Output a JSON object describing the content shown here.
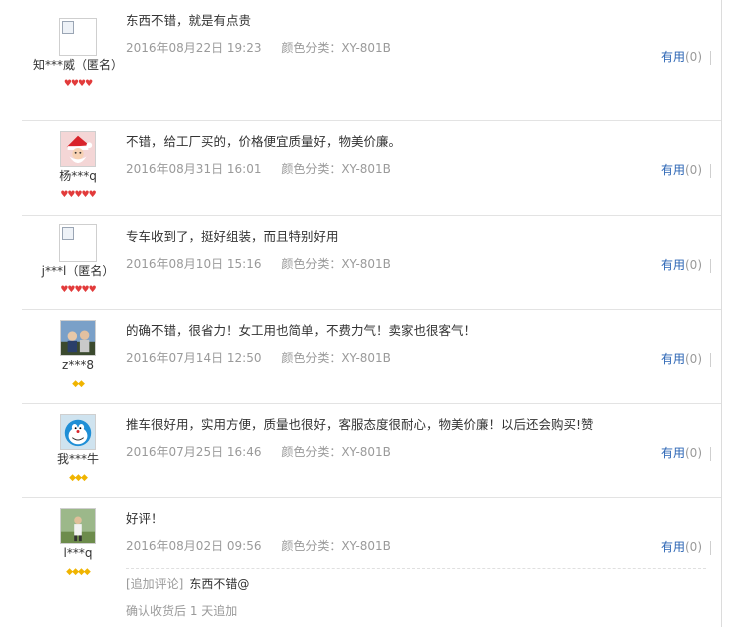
{
  "reviews": [
    {
      "user": "知***威（匿名）",
      "avatar": "broken-image-icon",
      "rank": "♥♥♥♥",
      "rank_type": "heart",
      "text": "东西不错，就是有点贵",
      "date": "2016年08月22日 19:23",
      "color": "颜色分类：XY-801B",
      "useful_label": "有用",
      "useful_count": "(0)"
    },
    {
      "user": "杨***q",
      "avatar": "santa-avatar",
      "rank": "♥♥♥♥♥",
      "rank_type": "heart",
      "text": "不错，给工厂买的，价格便宜质量好，物美价廉。",
      "date": "2016年08月31日 16:01",
      "color": "颜色分类：XY-801B",
      "useful_label": "有用",
      "useful_count": "(0)"
    },
    {
      "user": "j***l（匿名）",
      "avatar": "broken-image-icon",
      "rank": "♥♥♥♥♥",
      "rank_type": "heart",
      "text": "专车收到了，挺好组装，而且特别好用",
      "date": "2016年08月10日 15:16",
      "color": "颜色分类：XY-801B",
      "useful_label": "有用",
      "useful_count": "(0)"
    },
    {
      "user": "z***8",
      "avatar": "photo-avatar",
      "rank": "◆◆",
      "rank_type": "diamond",
      "text": "的确不错，很省力！女工用也简单，不费力气！卖家也很客气！",
      "date": "2016年07月14日 12:50",
      "color": "颜色分类：XY-801B",
      "useful_label": "有用",
      "useful_count": "(0)"
    },
    {
      "user": "我***牛",
      "avatar": "doraemon-avatar",
      "rank": "◆◆◆",
      "rank_type": "diamond",
      "text": "推车很好用，实用方便，质量也很好，客服态度很耐心，物美价廉！以后还会购买!赞",
      "date": "2016年07月25日 16:46",
      "color": "颜色分类：XY-801B",
      "useful_label": "有用",
      "useful_count": "(0)"
    },
    {
      "user": "l***q",
      "avatar": "outdoor-photo-avatar",
      "rank": "◆◆◆◆",
      "rank_type": "diamond",
      "text": "好评！",
      "date": "2016年08月02日 09:56",
      "color": "颜色分类：XY-801B",
      "useful_label": "有用",
      "useful_count": "(0)",
      "append_tag": "[追加评论]",
      "append_text": "东西不错@",
      "append_note": "确认收货后 1 天追加"
    }
  ]
}
